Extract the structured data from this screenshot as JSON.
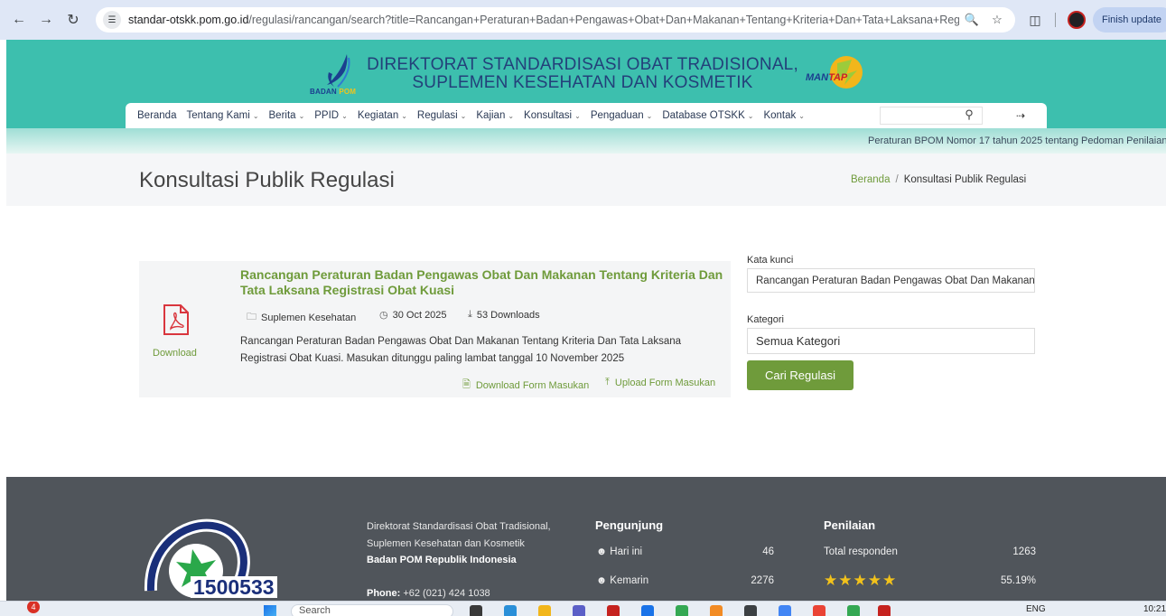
{
  "browser": {
    "url_host": "standar-otskk.pom.go.id",
    "url_path": "/regulasi/rancangan/search?title=Rancangan+Peraturan+Badan+Pengawas+Obat+Dan+Makanan+Tentang+Kriteria+Dan+Tata+Laksana+Registrasi+...",
    "finish_update_label": "Finish update"
  },
  "header": {
    "logo_left_text_a": "BADAN",
    "logo_left_text_b": "POM",
    "title_line1": "DIREKTORAT STANDARDISASI OBAT TRADISIONAL,",
    "title_line2": "SUPLEMEN KESEHATAN DAN KOSMETIK",
    "logo_right_text_a": "MAN",
    "logo_right_text_b": "TAP"
  },
  "nav": {
    "items": [
      {
        "label": "Beranda",
        "dropdown": false
      },
      {
        "label": "Tentang Kami",
        "dropdown": true
      },
      {
        "label": "Berita",
        "dropdown": true
      },
      {
        "label": "PPID",
        "dropdown": true
      },
      {
        "label": "Kegiatan",
        "dropdown": true
      },
      {
        "label": "Regulasi",
        "dropdown": true
      },
      {
        "label": "Kajian",
        "dropdown": true
      },
      {
        "label": "Konsultasi",
        "dropdown": true
      },
      {
        "label": "Pengaduan",
        "dropdown": true
      },
      {
        "label": "Database OTSKK",
        "dropdown": true
      },
      {
        "label": "Kontak",
        "dropdown": true
      }
    ],
    "search_value": ""
  },
  "ticker": {
    "text": "Peraturan BPOM Nomor 17 tahun 2025 tentang Pedoman Penilaian"
  },
  "page": {
    "title": "Konsultasi Publik Regulasi",
    "breadcrumb_home": "Beranda",
    "breadcrumb_sep": "/",
    "breadcrumb_current": "Konsultasi Publik Regulasi"
  },
  "result": {
    "download_label": "Download",
    "title": "Rancangan Peraturan Badan Pengawas Obat Dan Makanan Tentang Kriteria Dan Tata Laksana Registrasi Obat Kuasi",
    "category": "Suplemen Kesehatan",
    "date": "30 Oct 2025",
    "downloads": "53 Downloads",
    "description": "Rancangan Peraturan Badan Pengawas Obat Dan Makanan Tentang Kriteria Dan Tata Laksana Registrasi Obat Kuasi. Masukan ditunggu paling lambat tanggal 10 November 2025",
    "download_form_label": "Download Form Masukan",
    "upload_form_label": "Upload Form Masukan"
  },
  "search_form": {
    "keyword_label": "Kata kunci",
    "keyword_value": "Rancangan Peraturan Badan Pengawas Obat Dan Makanan",
    "category_label": "Kategori",
    "category_value": "Semua Kategori",
    "submit_label": "Cari Regulasi"
  },
  "footer": {
    "call_number": "1500533",
    "org_line1": "Direktorat Standardisasi Obat Tradisional,",
    "org_line2": "Suplemen Kesehatan dan Kosmetik",
    "org_line3": "Badan POM Republik Indonesia",
    "phone_label": "Phone:",
    "phone_value": "+62 (021) 424 1038",
    "visitors_heading": "Pengunjung",
    "today_label": "Hari ini",
    "today_value": "46",
    "yesterday_label": "Kemarin",
    "yesterday_value": "2276",
    "rating_heading": "Penilaian",
    "total_label": "Total responden",
    "total_value": "1263",
    "rating_stars": 5,
    "rating_percent": "55.19%"
  },
  "taskbar": {
    "notification_count": "4",
    "search_placeholder": "Search",
    "language": "ENG",
    "time": "10:21"
  }
}
